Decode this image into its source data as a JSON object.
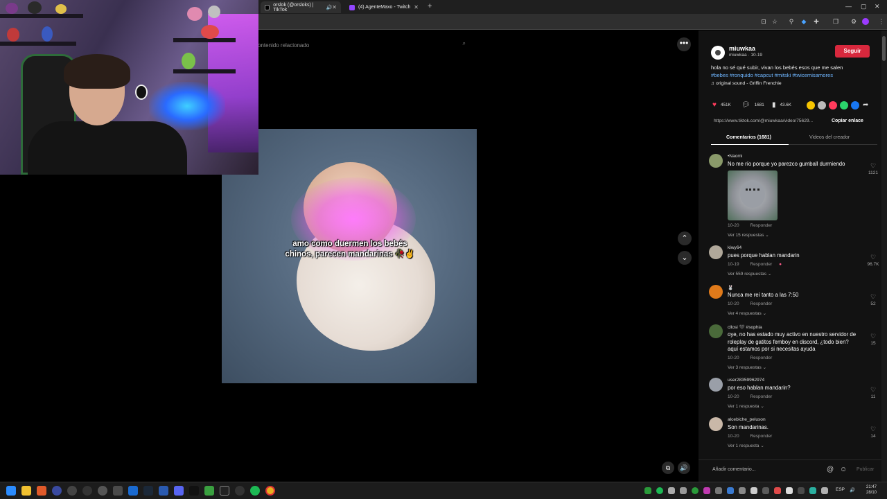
{
  "browser": {
    "tabs": [
      {
        "title": "orslok (@orsloks) | TikTok",
        "active": true
      },
      {
        "title": "(4) AgenteMaxo - Twitch",
        "active": false
      }
    ]
  },
  "page": {
    "search_placeholder": "ontenido relacionado",
    "video_caption": "amo como duermen los bebés chinos, parecen mandarinas 🥀✌️"
  },
  "post": {
    "author_name": "miuwkaa",
    "author_sub": "miuwkaa · 10-19",
    "follow_label": "Seguir",
    "description": "hola no sé qué subir, vivan los bebés esos que me salen",
    "hashtags": "#bebes #ronquido #capcut #mitski #twicemisamores",
    "sound": "♫  original sound - Griffin Frenchie",
    "likes": "451K",
    "comments_count": "1681",
    "saves": "43.6K",
    "link": "https://www.tiktok.com/@miuwkaa/video/75629...",
    "copy_link_label": "Copiar enlace",
    "tab_comments": "Comentarios (1681)",
    "tab_videos": "Videos del creador"
  },
  "comments": [
    {
      "user": "•Naomi",
      "text": "No me río porque yo parezco gumball durmiendo",
      "date": "10-20",
      "reply": "Responder",
      "replies": "Ver 15 respuestas ⌄",
      "likes": "1121"
    },
    {
      "user": "kiwy64",
      "text": "pues porque hablan mandarin",
      "date": "10-19",
      "reply": "Responder",
      "replies": "Ver 559 respuestas ⌄",
      "likes": "96.7K"
    },
    {
      "user": "🐰",
      "text": "Nunca me reí tanto a las 7:50",
      "date": "10-20",
      "reply": "Responder",
      "replies": "Ver 4 respuestas ⌄",
      "likes": "52"
    },
    {
      "user": "cllosi 🖤 #sophia",
      "text": "oye, no has estado muy activo en nuestro servidor de roleplay de gatitos femboy en discord, ¿todo bien? aquí estamos por si necesitas ayuda",
      "date": "10-20",
      "reply": "Responder",
      "replies": "Ver 3 respuestas ⌄",
      "likes": "15"
    },
    {
      "user": "user28359962974",
      "text": "por eso hablan mandarin?",
      "date": "10-20",
      "reply": "Responder",
      "replies": "Ver 1 respuesta ⌄",
      "likes": "11"
    },
    {
      "user": "alcebiche_peluson",
      "text": "Son mandarinas.",
      "date": "10-20",
      "reply": "Responder",
      "replies": "Ver 1 respuesta ⌄",
      "likes": "14"
    }
  ],
  "add_comment": {
    "placeholder": "Añadir comentario...",
    "post_label": "Publicar"
  },
  "taskbar": {
    "lang": "ESP",
    "time": "21:47",
    "date": "28/10"
  },
  "colors": {
    "follow": "#d8283d",
    "hashtag": "#6fb6ff",
    "like_heart": "#ff3b5c"
  }
}
